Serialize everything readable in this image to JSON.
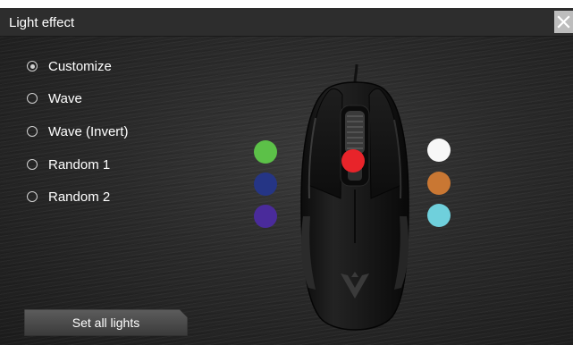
{
  "window": {
    "title": "Light effect"
  },
  "close_button": {
    "icon": "close-icon"
  },
  "effects": {
    "selected": "Customize",
    "options": [
      {
        "label": "Customize",
        "selected": true
      },
      {
        "label": "Wave",
        "selected": false
      },
      {
        "label": "Wave (Invert)",
        "selected": false
      },
      {
        "label": "Random 1",
        "selected": false
      },
      {
        "label": "Random 2",
        "selected": false
      }
    ]
  },
  "zones": {
    "left": [
      {
        "name": "green",
        "color": "#5cc148"
      },
      {
        "name": "navy",
        "color": "#253585"
      },
      {
        "name": "purple",
        "color": "#4a2b9b"
      }
    ],
    "right": [
      {
        "name": "white",
        "color": "#f7f7f7"
      },
      {
        "name": "orange",
        "color": "#c97733"
      },
      {
        "name": "cyan",
        "color": "#6fd0dc"
      }
    ],
    "wheel": {
      "name": "red",
      "color": "#e8242a"
    }
  },
  "actions": {
    "set_all_label": "Set all lights"
  }
}
